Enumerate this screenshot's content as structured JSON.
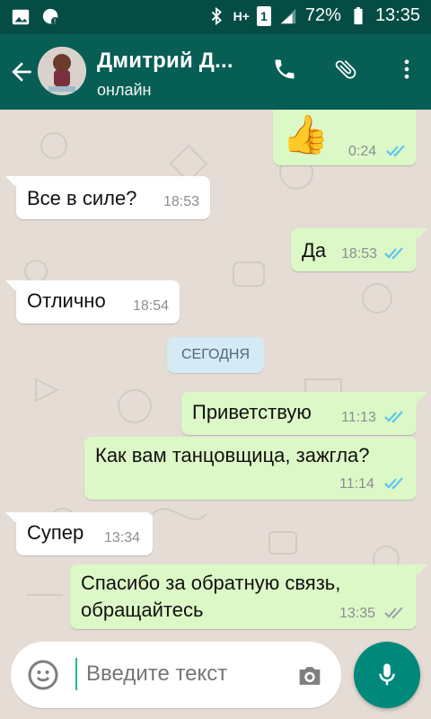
{
  "status_bar": {
    "battery": "72%",
    "time": "13:35",
    "network": "H+",
    "sim": "1",
    "icons": [
      "gallery-icon",
      "whatsapp-notification-icon",
      "bluetooth-icon",
      "signal-icon",
      "battery-icon"
    ]
  },
  "app_bar": {
    "title": "Дмитрий Д...",
    "subtitle": "онлайн",
    "actions": [
      "phone-icon",
      "attachment-icon",
      "more-vert-icon"
    ],
    "brand_color": "#075e54"
  },
  "messages": [
    {
      "direction": "out",
      "text": "👍",
      "time": "0:24",
      "status": "read"
    },
    {
      "direction": "in",
      "text": "Все в силе?",
      "time": "18:53"
    },
    {
      "direction": "out",
      "text": "Да",
      "time": "18:53",
      "status": "read"
    },
    {
      "direction": "in",
      "text": "Отлично",
      "time": "18:54"
    },
    {
      "direction": "system",
      "text": "СЕГОДНЯ"
    },
    {
      "direction": "out",
      "text": "Приветствую",
      "time": "11:13",
      "status": "read"
    },
    {
      "direction": "out",
      "text": "Как вам танцовщица, зажгла?",
      "time": "11:14",
      "status": "read"
    },
    {
      "direction": "in",
      "text": "Супер",
      "time": "13:34"
    },
    {
      "direction": "out",
      "text": "Спасибо за обратную связь,",
      "text2": "обращайтесь",
      "time": "13:35",
      "status": "delivered"
    }
  ],
  "composer": {
    "placeholder": "Введите текст",
    "accent": "#00897b"
  }
}
